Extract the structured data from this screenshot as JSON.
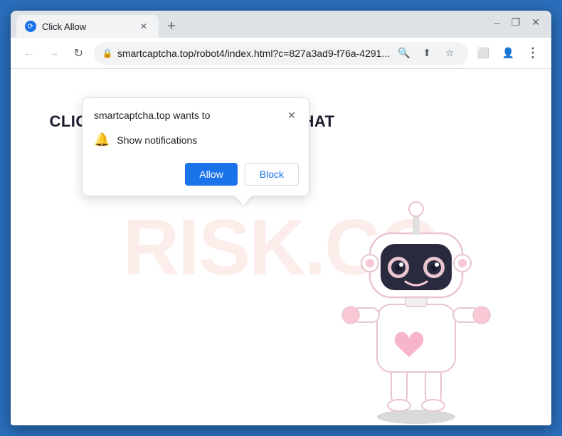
{
  "window": {
    "title": "Click Allow",
    "controls": {
      "minimize": "–",
      "maximize": "□",
      "close": "✕",
      "restore": "⌵"
    }
  },
  "tabs": [
    {
      "label": "Click Allow",
      "active": true
    }
  ],
  "new_tab_label": "+",
  "address_bar": {
    "url": "smartcaptcha.top/robot4/index.html?c=827a3ad9-f76a-4291...",
    "lock_icon": "🔒"
  },
  "nav": {
    "back": "←",
    "forward": "→",
    "refresh": "↻"
  },
  "notification_popup": {
    "title": "smartcaptcha.top wants to",
    "notification_label": "Show notifications",
    "allow_button": "Allow",
    "block_button": "Block",
    "close_icon": "✕"
  },
  "page": {
    "main_text": "CLICK «ALLOW» TO CONFIRM THAT YOU ARE NOT A ROBOT!",
    "watermark": "RISK.CO"
  }
}
